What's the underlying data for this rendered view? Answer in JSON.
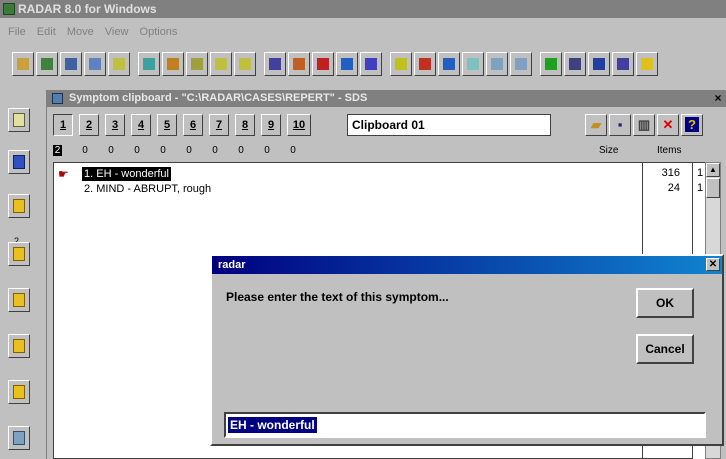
{
  "app": {
    "title": "RADAR 8.0 for Windows"
  },
  "menu": [
    "File",
    "Edit",
    "Move",
    "View",
    "Options"
  ],
  "toolbar": {
    "icons": [
      "clipboard-icon",
      "search-icon",
      "book-icon",
      "zoom-icon",
      "pencil-icon",
      "graph-icon",
      "repertory-icon",
      "open-book-icon",
      "notes-icon",
      "edit-book-icon",
      "chart-icon",
      "calculator-icon",
      "table-icon",
      "people-icon",
      "analysis-icon",
      "globe-icon",
      "remedy-icon",
      "arrows-icon",
      "tool-icon",
      "grid-icon",
      "module-icon",
      "world-icon",
      "print-icon",
      "stats-icon",
      "info-icon",
      "help-icon"
    ],
    "colors": [
      "#c8a040",
      "#408040",
      "#4060a0",
      "#6080c0",
      "#c0c040",
      "#40a0a0",
      "#c08020",
      "#a0a040",
      "#c0c040",
      "#c0c040",
      "#4040a0",
      "#c06020",
      "#c02020",
      "#2060c0",
      "#4040c0",
      "#c0c020",
      "#c03020",
      "#2060c0",
      "#80c0c0",
      "#80a0c0",
      "#80a0c0",
      "#20a020",
      "#404080",
      "#2040a0",
      "#4040a0",
      "#e0c020"
    ]
  },
  "leftbar": {
    "icons": [
      "key-icon",
      "clipboard-1-icon",
      "clipboard-2-icon",
      "clipboard-3-icon",
      "clipboard-4-icon",
      "clipboard-5-icon",
      "clipboard-6-icon",
      "clipboard-all-icon"
    ],
    "small_number": "2"
  },
  "clipboard_window": {
    "title": "Symptom clipboard - \"C:\\RADAR\\CASES\\REPERT\" - SDS",
    "tabs": [
      "1",
      "2",
      "3",
      "4",
      "5",
      "6",
      "7",
      "8",
      "9",
      "10"
    ],
    "active_tab": "1",
    "clipboard_name": "Clipboard 01",
    "counts": [
      "2",
      "0",
      "0",
      "0",
      "0",
      "0",
      "0",
      "0",
      "0",
      "0"
    ],
    "header_size": "Size",
    "header_items": "Items",
    "actions": [
      "open-folder-icon",
      "save-icon",
      "trash-icon",
      "delete-icon",
      "help-icon"
    ],
    "rows": [
      {
        "label": "1. EH - wonderful",
        "size": "316",
        "items": "1",
        "selected": true
      },
      {
        "label": "2. MIND - ABRUPT, rough",
        "size": "24",
        "items": "1",
        "selected": false
      }
    ]
  },
  "dialog": {
    "title": "radar",
    "prompt": "Please enter the text of this symptom...",
    "ok_label": "OK",
    "cancel_label": "Cancel",
    "input_value": "EH - wonderful"
  }
}
